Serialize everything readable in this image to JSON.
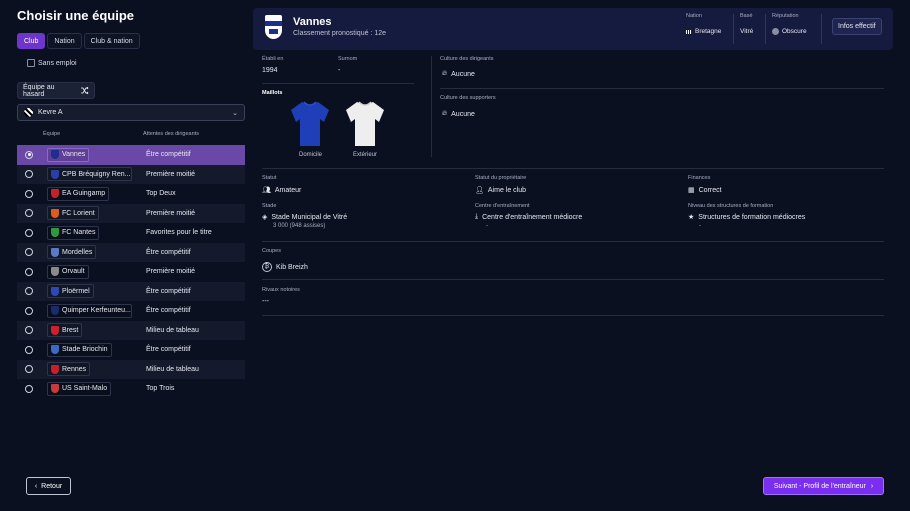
{
  "page": {
    "title": "Choisir une équipe"
  },
  "tabs": [
    {
      "label": "Club",
      "active": true
    },
    {
      "label": "Nation",
      "active": false
    },
    {
      "label": "Club & nation",
      "active": false
    }
  ],
  "unemployed": {
    "label": "Sans emploi",
    "checked": false
  },
  "random_button": {
    "label": "Équipe au hasard"
  },
  "league_select": {
    "value": "Kevre A"
  },
  "table": {
    "col_team": "Équipe",
    "col_expectation": "Attentes des dirigeants",
    "rows": [
      {
        "name": "Vannes",
        "expectation": "Être compétitif",
        "selected": true,
        "crest_color": "#1e2e8e"
      },
      {
        "name": "CPB Bréquigny Ren...",
        "expectation": "Première moitié",
        "selected": false,
        "crest_color": "#2a3ea8"
      },
      {
        "name": "EA Guingamp",
        "expectation": "Top Deux",
        "selected": false,
        "crest_color": "#c8202a"
      },
      {
        "name": "FC Lorient",
        "expectation": "Première moitié",
        "selected": false,
        "crest_color": "#e05a1a"
      },
      {
        "name": "FC Nantes",
        "expectation": "Favorites pour le titre",
        "selected": false,
        "crest_color": "#2e9a3a"
      },
      {
        "name": "Mordelles",
        "expectation": "Être compétitif",
        "selected": false,
        "crest_color": "#5a7ac8"
      },
      {
        "name": "Orvault",
        "expectation": "Première moitié",
        "selected": false,
        "crest_color": "#8a8a8a"
      },
      {
        "name": "Ploërmel",
        "expectation": "Être compétitif",
        "selected": false,
        "crest_color": "#2a4ab8"
      },
      {
        "name": "Quimper Kerfeunteu...",
        "expectation": "Être compétitif",
        "selected": false,
        "crest_color": "#1a2a6a"
      },
      {
        "name": "Brest",
        "expectation": "Milieu de tableau",
        "selected": false,
        "crest_color": "#d02030"
      },
      {
        "name": "Stade Briochin",
        "expectation": "Être compétitif",
        "selected": false,
        "crest_color": "#3a6ac8"
      },
      {
        "name": "Rennes",
        "expectation": "Milieu de tableau",
        "selected": false,
        "crest_color": "#c81e2a"
      },
      {
        "name": "US Saint-Malo",
        "expectation": "Top Trois",
        "selected": false,
        "crest_color": "#c83a3a"
      }
    ]
  },
  "club": {
    "name": "Vannes",
    "rank": "Classement pronostiqué : 12e",
    "nation_label": "Nation",
    "nation": "Bretagne",
    "based_label": "Basé",
    "based": "Vitré",
    "reputation_label": "Réputation",
    "reputation": "Obscure",
    "info_button": "Infos effectif",
    "founded_label": "Établi en",
    "founded": "1994",
    "nickname_label": "Surnom",
    "nickname": "-",
    "board_culture_label": "Culture des dirigeants",
    "board_culture": "Aucune",
    "fan_culture_label": "Culture des supporters",
    "fan_culture": "Aucune",
    "kits_label": "Maillots",
    "kit_home": "Domicile",
    "kit_away": "Extérieur",
    "status_label": "Statut",
    "status": "Amateur",
    "owner_label": "Statut du propriétaire",
    "owner": "Aime le club",
    "finances_label": "Finances",
    "finances": "Correct",
    "stadium_label": "Stade",
    "stadium": "Stade Municipal de Vitré",
    "stadium_cap": "3 000 (948 assises)",
    "training_label": "Centre d'entraînement",
    "training": "Centre d'entraînement médiocre",
    "training_sub": "-",
    "youth_label": "Niveau des structures de formation",
    "youth": "Structures de formation médiocres",
    "youth_sub": "-",
    "cups_label": "Coupes",
    "cups": "Kib Breizh",
    "rivals_label": "Rivaux notoires",
    "rivals": "---"
  },
  "footer": {
    "back": "Retour",
    "next": "Suivant - Profil de l'entraîneur"
  },
  "colors": {
    "accent": "#7a2ef0",
    "selected_row": "#6a48a8",
    "header_panel": "#151a3f"
  }
}
